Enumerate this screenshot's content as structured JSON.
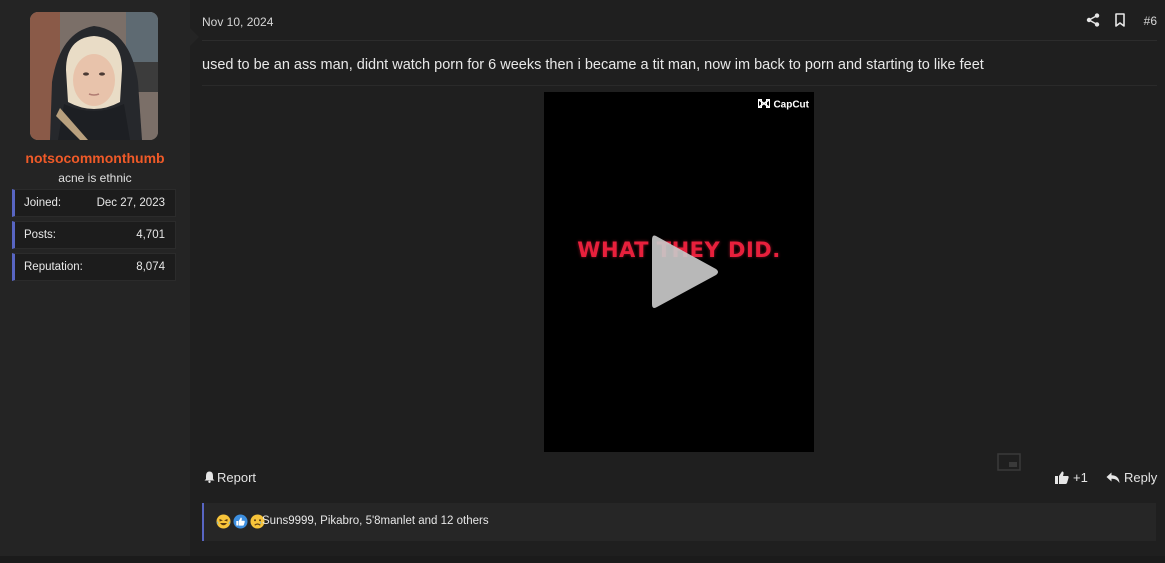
{
  "user": {
    "name": "notsocommonthumb",
    "title": "acne is ethnic",
    "stats": [
      {
        "label": "Joined:",
        "value": "Dec 27, 2023"
      },
      {
        "label": "Posts:",
        "value": "4,701"
      },
      {
        "label": "Reputation:",
        "value": "8,074"
      }
    ]
  },
  "post": {
    "date": "Nov 10, 2024",
    "number": "#6",
    "text": "used to be an ass man, didnt watch porn for 6 weeks then i became a tit man, now im back to porn and starting to like feet",
    "video": {
      "watermark": "CapCut",
      "caption": "WHAT THEY DID."
    }
  },
  "actions": {
    "report": "Report",
    "like_count": "+1",
    "reply": "Reply"
  },
  "reactions": {
    "icons": [
      "laughing-crying-emoji-icon",
      "thumbs-up-emoji-icon",
      "sad-emoji-icon"
    ],
    "text": "Suns9999, Pikabro, 5'8manlet and 12 others"
  },
  "colors": {
    "username": "#f05a28",
    "accent": "#5865c2",
    "caption": "#e8203c"
  }
}
